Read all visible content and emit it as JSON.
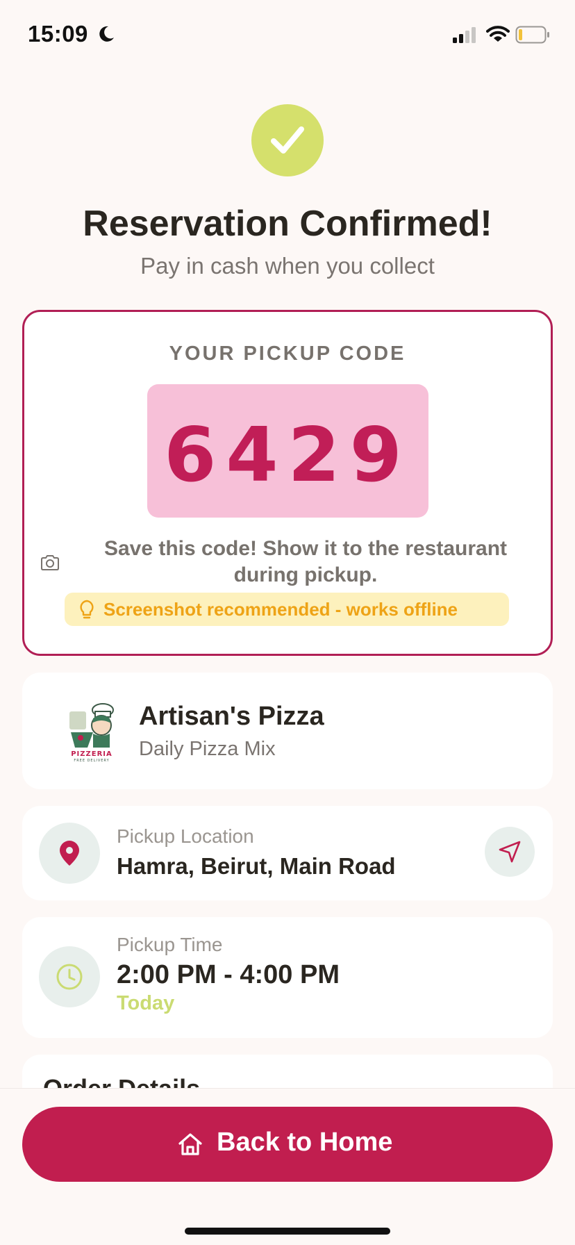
{
  "status_bar": {
    "time": "15:09"
  },
  "confirmation": {
    "title": "Reservation Confirmed!",
    "subtitle": "Pay in cash when you collect"
  },
  "pickup_code": {
    "heading": "YOUR PICKUP CODE",
    "code": "6429",
    "instructions": "Save this code! Show it to the restaurant during pickup.",
    "tip": "Screenshot recommended - works offline"
  },
  "restaurant": {
    "name": "Artisan's Pizza",
    "item": "Daily Pizza Mix",
    "logo_text": "PIZZERIA",
    "logo_subtext": "FREE DELIVERY"
  },
  "location": {
    "label": "Pickup Location",
    "value": "Hamra, Beirut, Main Road"
  },
  "pickup_time": {
    "label": "Pickup Time",
    "value": "2:00 PM - 4:00 PM",
    "day": "Today"
  },
  "order_details": {
    "title": "Order Details"
  },
  "footer": {
    "home_button": "Back to Home"
  },
  "colors": {
    "accent": "#c11e4f",
    "success": "#d5e06c",
    "code_bg": "#f7c0d8",
    "tip_bg": "#fdf1bd",
    "tip_text": "#eea316",
    "today": "#cadb72"
  },
  "icons": [
    "moon-icon",
    "signal-icon",
    "wifi-icon",
    "battery-icon",
    "check-icon",
    "camera-icon",
    "bulb-icon",
    "location-pin-icon",
    "navigation-arrow-icon",
    "clock-icon",
    "home-icon"
  ]
}
